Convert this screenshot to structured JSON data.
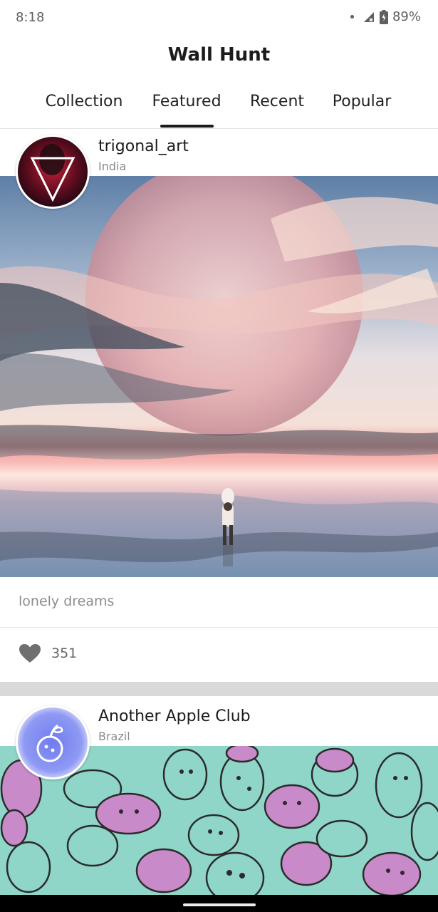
{
  "status": {
    "time": "8:18",
    "battery": "89%"
  },
  "app": {
    "title": "Wall Hunt"
  },
  "tabs": [
    {
      "label": "Collection",
      "active": false
    },
    {
      "label": "Featured",
      "active": true
    },
    {
      "label": "Recent",
      "active": false
    },
    {
      "label": "Popular",
      "active": false
    }
  ],
  "posts": [
    {
      "author": "trigonal_art",
      "location": "India",
      "caption": "lonely dreams",
      "likes": "351",
      "icon": "heart-icon"
    },
    {
      "author": "Another Apple Club",
      "location": "Brazil"
    }
  ],
  "colors": {
    "accent": "#1b1b1b",
    "secondary_text": "#8a8a8a",
    "divider": "#e4e4e4"
  }
}
